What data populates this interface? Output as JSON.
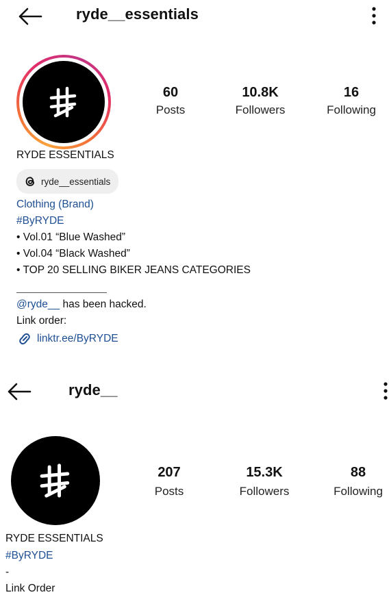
{
  "profile1": {
    "handle": "ryde__essentials",
    "stats": {
      "posts": {
        "value": "60",
        "label": "Posts"
      },
      "followers": {
        "value": "10.8K",
        "label": "Followers"
      },
      "following": {
        "value": "16",
        "label": "Following"
      }
    },
    "name": "RYDE ESSENTIALS",
    "threads_handle": "ryde__essentials",
    "category": "Clothing (Brand)",
    "hashtag": "#ByRYDE",
    "bio_lines": [
      "• Vol.01 “Blue Washed”",
      "• Vol.04 “Black Washed”",
      "• TOP 20 SELLING BIKER JEANS CATEGORIES"
    ],
    "mention": "@ryde__",
    "hacked_text": " has been hacked.",
    "link_order": "Link order:",
    "link": "linktr.ee/ByRYDE"
  },
  "profile2": {
    "handle": "ryde__",
    "stats": {
      "posts": {
        "value": "207",
        "label": "Posts"
      },
      "followers": {
        "value": "15.3K",
        "label": "Followers"
      },
      "following": {
        "value": "88",
        "label": "Following"
      }
    },
    "name": "RYDE ESSENTIALS",
    "hashtag": "#ByRYDE",
    "dash": "-",
    "link_order": "Link Order"
  },
  "icons": {
    "back": "arrow-left-icon",
    "more": "vertical-dots-icon",
    "threads": "threads-icon",
    "link": "chain-link-icon",
    "logo": "ryde-hash-logo"
  }
}
